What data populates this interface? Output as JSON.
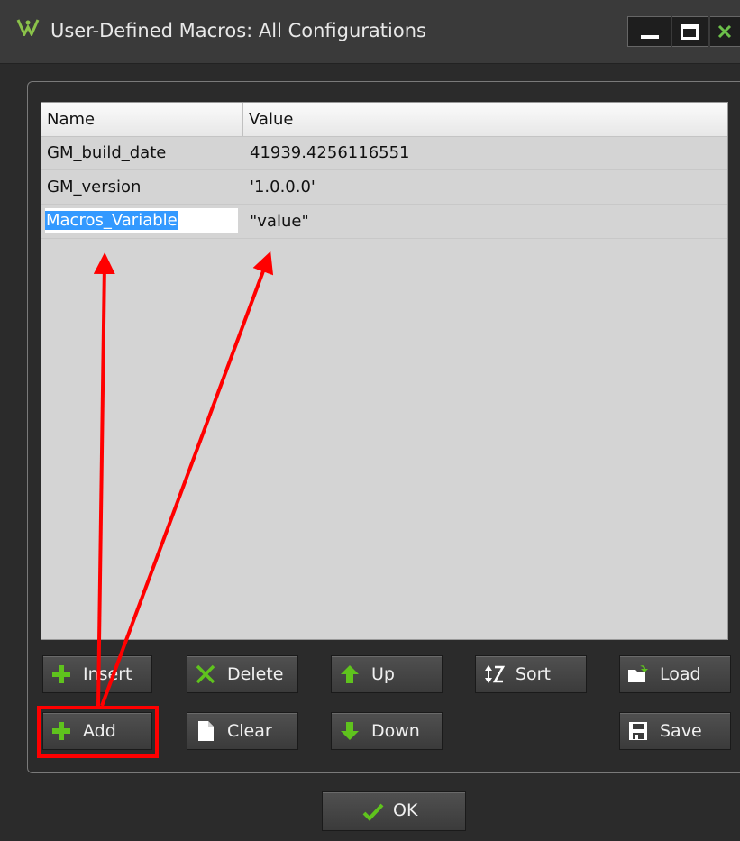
{
  "window": {
    "title": "User-Defined Macros: All Configurations",
    "controls": [
      "minimize",
      "maximize",
      "close"
    ]
  },
  "table": {
    "columns": [
      "Name",
      "Value"
    ],
    "rows": [
      {
        "name": "GM_build_date",
        "value": "41939.4256116551"
      },
      {
        "name": "GM_version",
        "value": "'1.0.0.0'"
      },
      {
        "name": "Macros_Variable",
        "value": "\"value\"",
        "editing": true
      }
    ]
  },
  "buttons": {
    "insert": {
      "label": "Insert",
      "icon": "plus-icon"
    },
    "delete": {
      "label": "Delete",
      "icon": "x-icon"
    },
    "up": {
      "label": "Up",
      "icon": "arrow-up-icon"
    },
    "sort": {
      "label": "Sort",
      "icon": "sort-icon"
    },
    "load": {
      "label": "Load",
      "icon": "folder-open-icon"
    },
    "add": {
      "label": "Add",
      "icon": "plus-icon"
    },
    "clear": {
      "label": "Clear",
      "icon": "document-icon"
    },
    "down": {
      "label": "Down",
      "icon": "arrow-down-icon"
    },
    "save": {
      "label": "Save",
      "icon": "floppy-disk-icon"
    },
    "ok": {
      "label": "OK",
      "icon": "checkmark-icon"
    }
  },
  "colors": {
    "window_bg": "#2b2b2b",
    "grid_bg": "#d4d4d4",
    "selection": "#3399ff",
    "icon_green": "#5fc31d",
    "annotation_red": "#ff0000"
  }
}
